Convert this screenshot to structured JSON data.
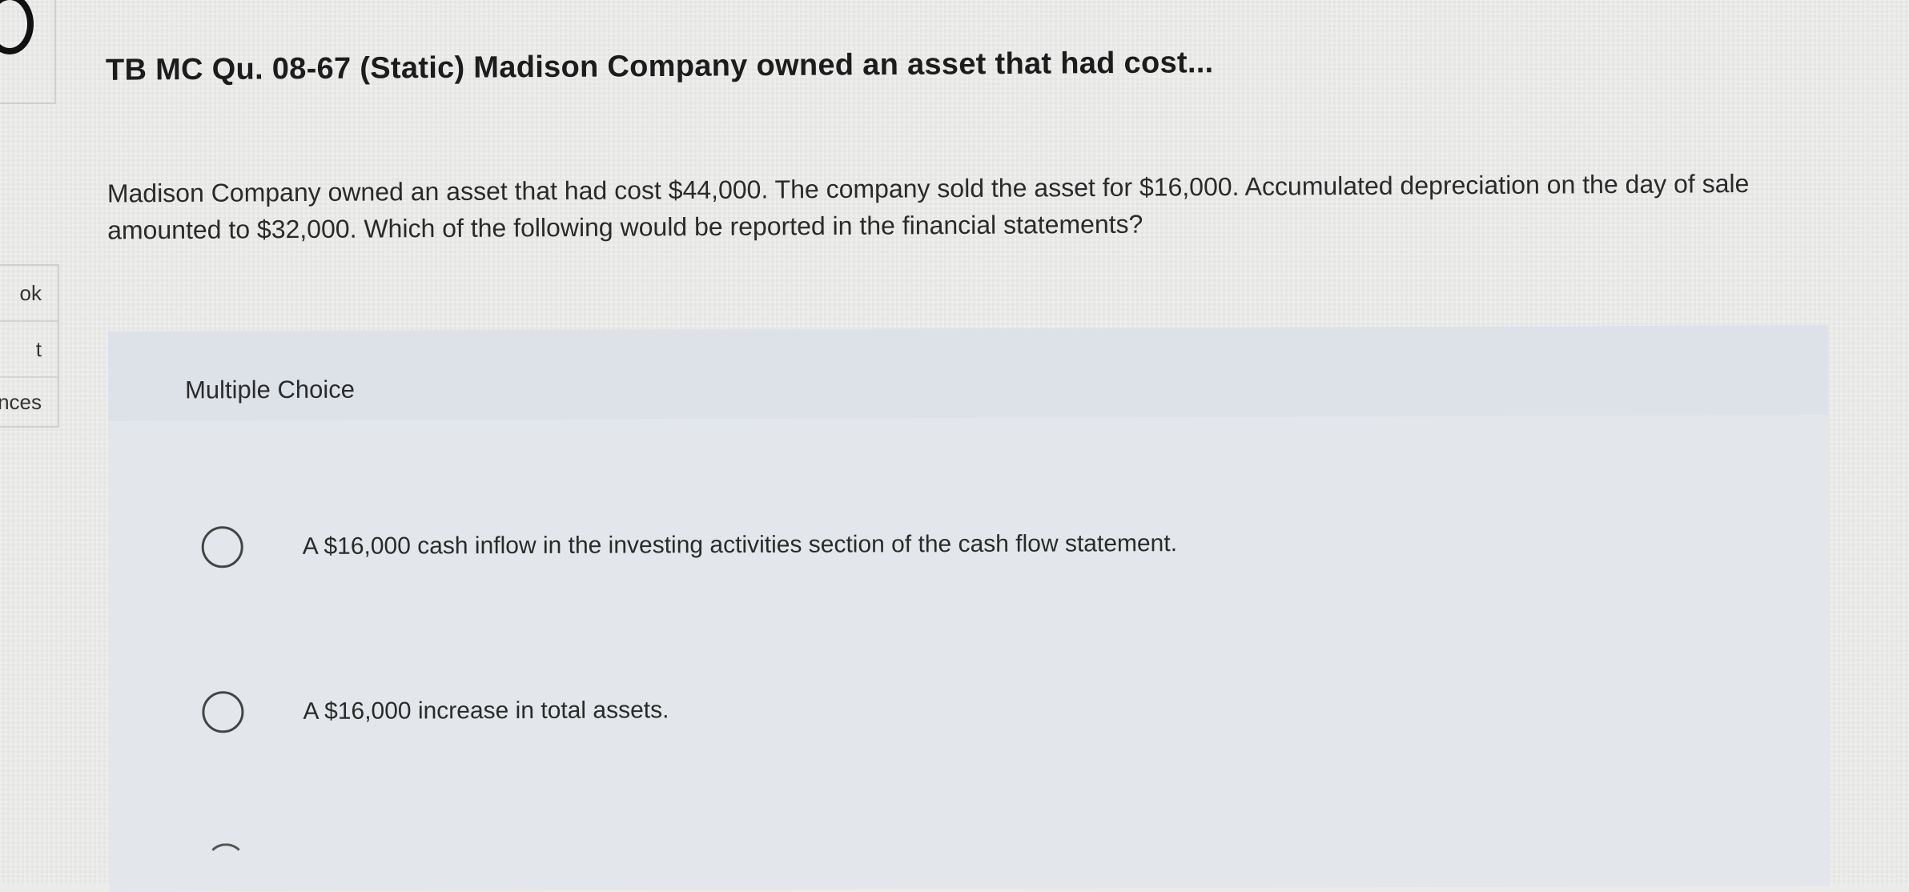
{
  "sidebar": {
    "items": [
      {
        "label": "ok"
      },
      {
        "label": "t"
      },
      {
        "label": "nces"
      }
    ]
  },
  "question": {
    "title": "TB MC Qu. 08-67 (Static) Madison Company owned an asset that had cost...",
    "text": "Madison Company owned an asset that had cost $44,000. The company sold the asset for $16,000. Accumulated depreciation on the day of sale amounted to $32,000. Which of the following would be reported in the financial statements?"
  },
  "multiple_choice": {
    "label": "Multiple Choice",
    "choices": [
      {
        "text": "A $16,000 cash inflow in the investing activities section of the cash flow statement."
      },
      {
        "text": "A $16,000 increase in total assets."
      }
    ]
  }
}
